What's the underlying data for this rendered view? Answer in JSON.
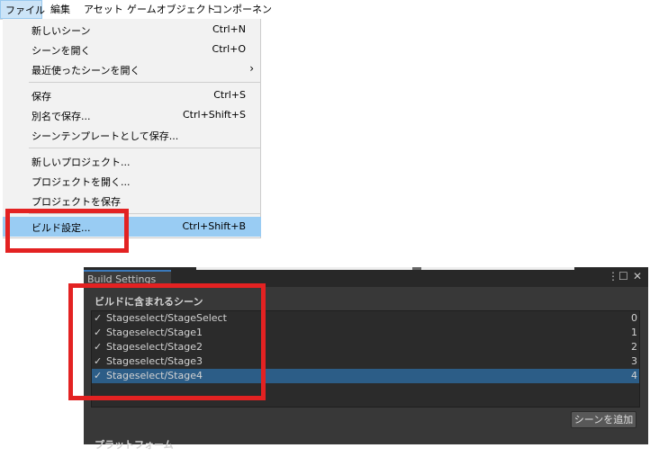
{
  "menubar": {
    "items": [
      {
        "label": "ファイル"
      },
      {
        "label": "編集"
      },
      {
        "label": "アセット"
      },
      {
        "label": "ゲームオブジェクト"
      },
      {
        "label": "コンポーネン"
      }
    ]
  },
  "file_menu": {
    "items": [
      {
        "label": "新しいシーン",
        "shortcut": "Ctrl+N"
      },
      {
        "label": "シーンを開く",
        "shortcut": "Ctrl+O"
      },
      {
        "label": "最近使ったシーンを開く",
        "submenu_arrow": "›"
      },
      {
        "label": "保存",
        "shortcut": "Ctrl+S"
      },
      {
        "label": "別名で保存...",
        "shortcut": "Ctrl+Shift+S"
      },
      {
        "label": "シーンテンプレートとして保存..."
      },
      {
        "label": "新しいプロジェクト..."
      },
      {
        "label": "プロジェクトを開く..."
      },
      {
        "label": "プロジェクトを保存"
      },
      {
        "label": "ビルド設定...",
        "shortcut": "Ctrl+Shift+B",
        "highlighted": true
      }
    ]
  },
  "build_settings": {
    "tab_title": "Build Settings",
    "window_controls": {
      "menu": "⋮",
      "maximize": "☐",
      "close": "✕"
    },
    "section_label": "ビルドに含まれるシーン",
    "scenes": [
      {
        "check": "✓",
        "name": "Stageselect/StageSelect",
        "index": "0"
      },
      {
        "check": "✓",
        "name": "Stageselect/Stage1",
        "index": "1"
      },
      {
        "check": "✓",
        "name": "Stageselect/Stage2",
        "index": "2"
      },
      {
        "check": "✓",
        "name": "Stageselect/Stage3",
        "index": "3"
      },
      {
        "check": "✓",
        "name": "Stageselect/Stage4",
        "index": "4",
        "selected": true
      }
    ],
    "add_scene_button": "シーンを追加",
    "platform_label": "プラットフォーム"
  },
  "colors": {
    "highlight_menu": "#99ccf3",
    "selected_row": "#2c5d87",
    "annotation_red": "#e32222",
    "panel_bg": "#383838"
  }
}
